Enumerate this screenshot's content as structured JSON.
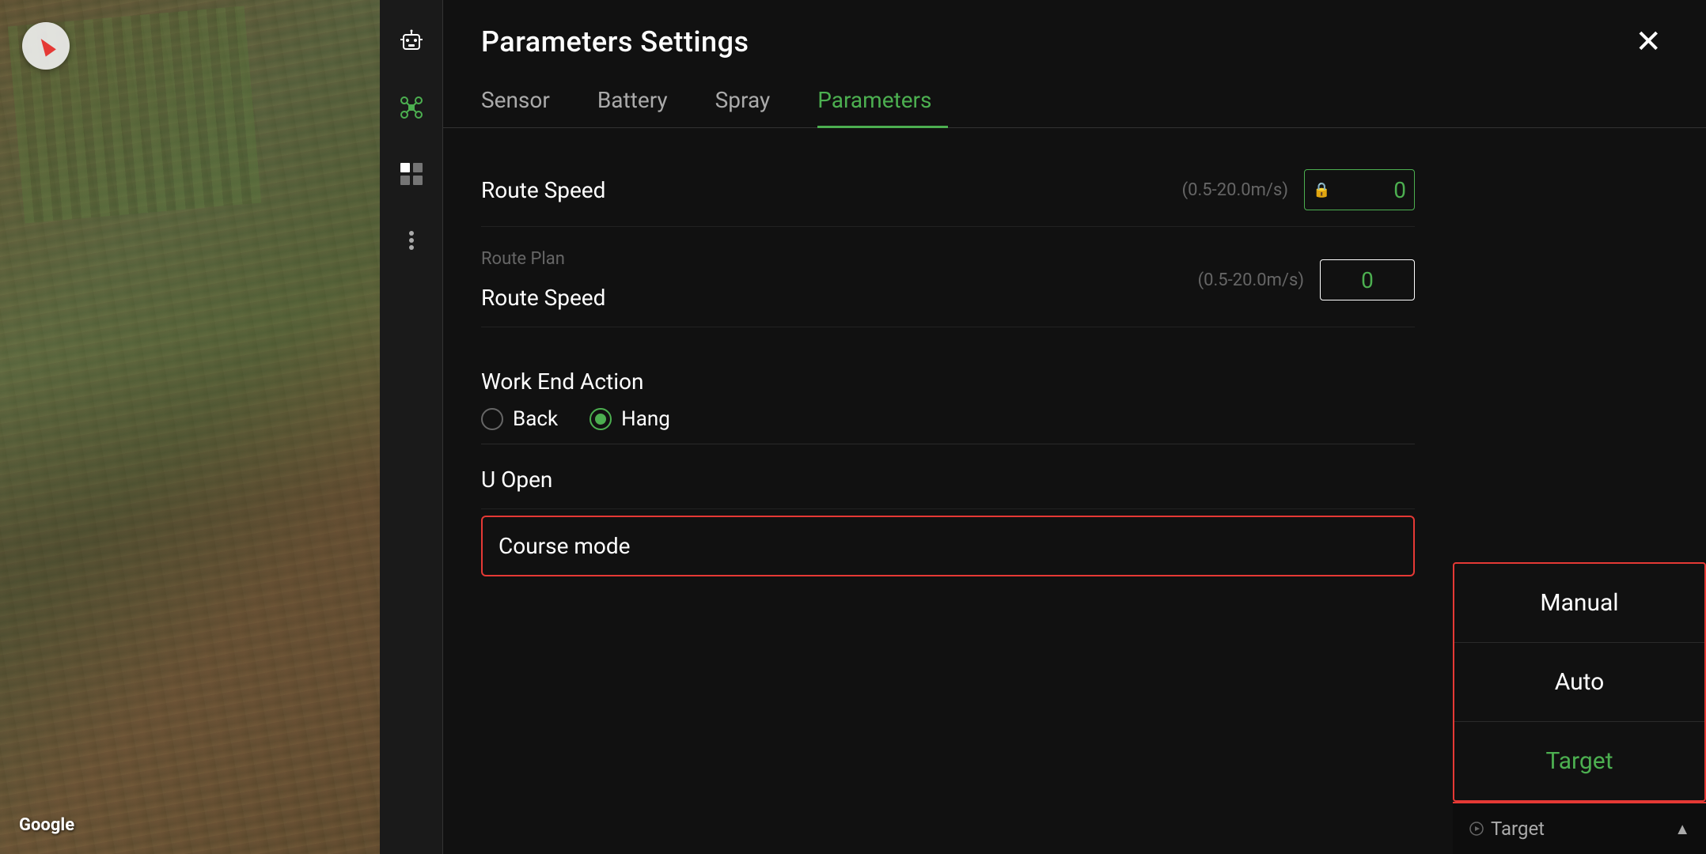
{
  "map": {
    "google_label": "Google",
    "compass_visible": true
  },
  "sidebar": {
    "icons": [
      {
        "name": "robot-icon",
        "symbol": "🤖",
        "color": "white"
      },
      {
        "name": "drone-icon",
        "symbol": "✤",
        "color": "green"
      },
      {
        "name": "grid-icon",
        "symbol": "⊞",
        "color": "white"
      },
      {
        "name": "more-icon",
        "dots": true
      }
    ]
  },
  "panel": {
    "title": "Parameters Settings",
    "close_label": "✕",
    "tabs": [
      {
        "id": "sensor",
        "label": "Sensor",
        "active": false
      },
      {
        "id": "battery",
        "label": "Battery",
        "active": false
      },
      {
        "id": "spray",
        "label": "Spray",
        "active": false
      },
      {
        "id": "parameters",
        "label": "Parameters",
        "active": true
      }
    ],
    "sections": {
      "route_speed_top": {
        "label": "Route Speed",
        "range": "(0.5-20.0m/s)",
        "value": "0",
        "has_lock": true
      },
      "route_plan": {
        "section_label": "Route Plan",
        "route_speed": {
          "label": "Route Speed",
          "range": "(0.5-20.0m/s)",
          "value": "0"
        }
      },
      "work_end_action": {
        "label": "Work End Action",
        "options": [
          {
            "id": "back",
            "label": "Back",
            "selected": false
          },
          {
            "id": "hang",
            "label": "Hang",
            "selected": true
          }
        ]
      },
      "u_open": {
        "label": "U Open"
      },
      "course_mode": {
        "label": "Course mode"
      }
    },
    "dropdown": {
      "items": [
        {
          "label": "Manual",
          "active": false
        },
        {
          "label": "Auto",
          "active": false
        },
        {
          "label": "Target",
          "active": true
        }
      ],
      "bottom_bar_label": "Target",
      "bottom_bar_icon": "chevron-up"
    }
  }
}
